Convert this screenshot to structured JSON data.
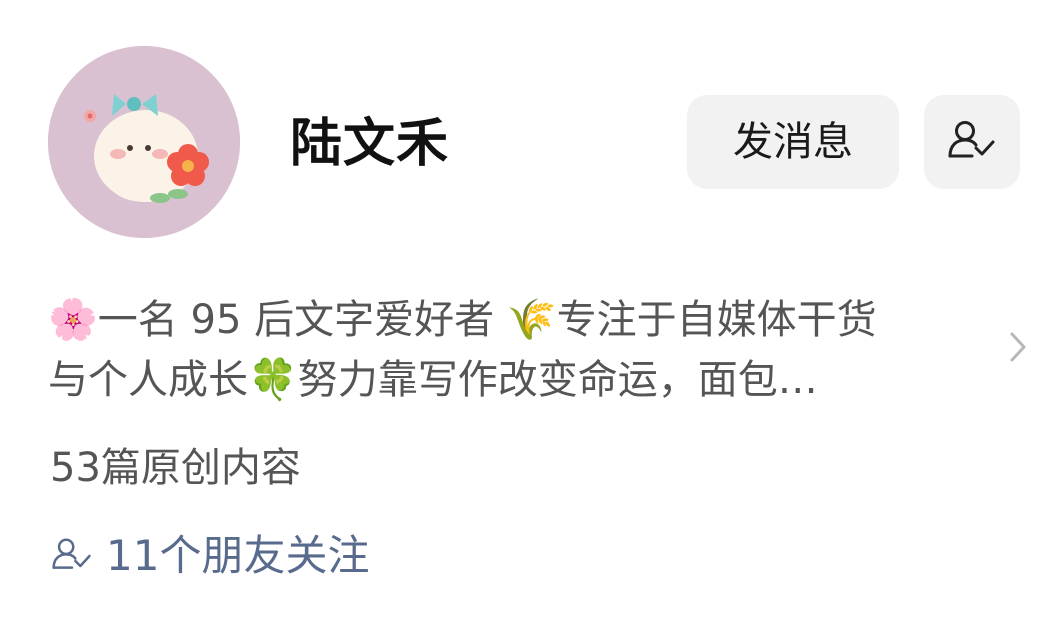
{
  "profile": {
    "name": "陆文禾",
    "message_button_label": "发消息",
    "bio_line1": "🌸一名 95 后文字爱好者 🌾专注于自媒体干货",
    "bio_line2": "与个人成长🍀努力靠写作改变命运，面包…",
    "original_count_text": "53篇原创内容",
    "friends_follow_text": "11个朋友关注"
  },
  "icons": {
    "follow_button": "person-check-icon",
    "bio_expand": "chevron-right-icon",
    "friends": "person-check-icon"
  },
  "colors": {
    "button_bg": "#f2f2f2",
    "link_text": "#586b8c",
    "secondary_text": "#555555",
    "avatar_bg": "#d9c1d1"
  }
}
